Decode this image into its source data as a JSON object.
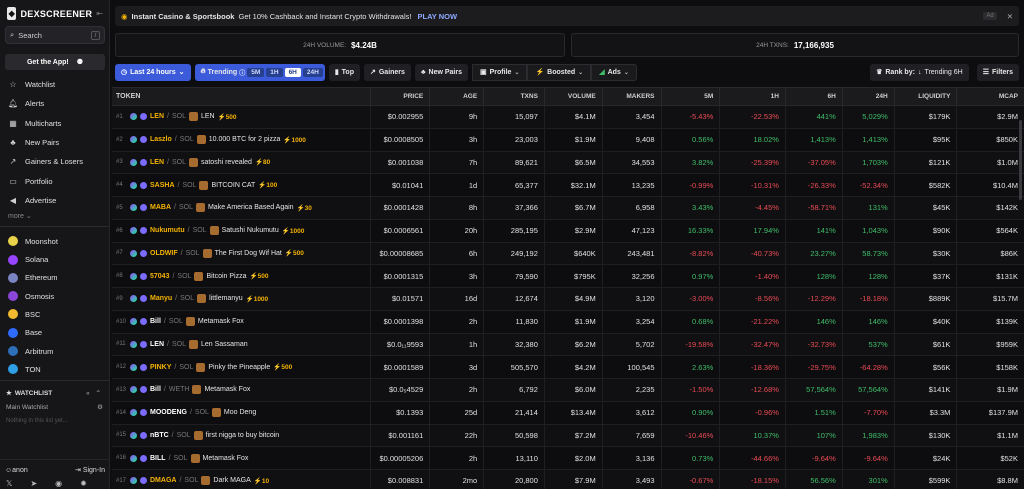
{
  "sidebar": {
    "logo": "DEXSCREENER",
    "search_label": "Search",
    "search_key": "/",
    "get_app": "Get the App!",
    "nav": [
      {
        "label": "Watchlist",
        "icon": "star-icon",
        "glyph": "☆"
      },
      {
        "label": "Alerts",
        "icon": "bell-icon",
        "glyph": "🔔︎"
      },
      {
        "label": "Multicharts",
        "icon": "grid-icon",
        "glyph": "▦"
      },
      {
        "label": "New Pairs",
        "icon": "sprout-icon",
        "glyph": "♣"
      },
      {
        "label": "Gainers & Losers",
        "icon": "trend-icon",
        "glyph": "↗"
      },
      {
        "label": "Portfolio",
        "icon": "folder-icon",
        "glyph": "▭"
      },
      {
        "label": "Advertise",
        "icon": "megaphone-icon",
        "glyph": "◀"
      }
    ],
    "more": "more",
    "chains": [
      {
        "label": "Moonshot",
        "color": "#e8d24a"
      },
      {
        "label": "Solana",
        "color": "#9945ff"
      },
      {
        "label": "Ethereum",
        "color": "#7a84c2"
      },
      {
        "label": "Osmosis",
        "color": "#8b46d9"
      },
      {
        "label": "BSC",
        "color": "#f3ba2f"
      },
      {
        "label": "Base",
        "color": "#2f6bff"
      },
      {
        "label": "Arbitrum",
        "color": "#2d6fb8"
      },
      {
        "label": "TON",
        "color": "#2fa0e6"
      }
    ],
    "watchlist_title": "WATCHLIST",
    "main_watchlist": "Main Watchlist",
    "empty_text": "Nothing in this list yet...",
    "user": "anon",
    "signin": "Sign-In"
  },
  "banner": {
    "brand": "Instant Casino & Sportsbook",
    "text": "Get 10% Cashback and Instant Crypto Withdrawals!",
    "cta": "PLAY NOW",
    "ad": "Ad"
  },
  "stats": {
    "volume_label": "24H VOLUME:",
    "volume_value": "$4.24B",
    "txns_label": "24H TXNS:",
    "txns_value": "17,166,935"
  },
  "toolbar": {
    "timeframe": "Last 24 hours",
    "trending": "Trending",
    "periods": [
      "5M",
      "1H",
      "6H",
      "24H"
    ],
    "selected_period": "6H",
    "top": "Top",
    "gainers": "Gainers",
    "new_pairs": "New Pairs",
    "profile": "Profile",
    "boosted": "Boosted",
    "ads": "Ads",
    "rank_by": "Rank by:",
    "rank_value": "Trending 6H",
    "filters": "Filters"
  },
  "columns": [
    "TOKEN",
    "PRICE",
    "AGE",
    "TXNS",
    "VOLUME",
    "MAKERS",
    "5M",
    "1H",
    "6H",
    "24H",
    "LIQUIDITY",
    "MCAP"
  ],
  "rows": [
    {
      "rank": "#1",
      "sym": "LEN",
      "quote": "SOL",
      "name": "LEN",
      "boost": "500",
      "price": "$0.002955",
      "age": "9h",
      "txns": "15,097",
      "vol": "$4.1M",
      "makers": "3,454",
      "m5": "-5.43%",
      "h1": "-22.53%",
      "h6": "441%",
      "h24": "5,029%",
      "liq": "$179K",
      "mcap": "$2.9M"
    },
    {
      "rank": "#2",
      "sym": "Laszlo",
      "quote": "SOL",
      "name": "10.000 BTC for 2 pizza",
      "boost": "1000",
      "price": "$0.0008505",
      "age": "3h",
      "txns": "23,003",
      "vol": "$1.9M",
      "makers": "9,408",
      "m5": "0.56%",
      "h1": "18.02%",
      "h6": "1,413%",
      "h24": "1,413%",
      "liq": "$95K",
      "mcap": "$850K"
    },
    {
      "rank": "#3",
      "sym": "LEN",
      "quote": "SOL",
      "name": "satoshi revealed",
      "boost": "80",
      "price": "$0.001038",
      "age": "7h",
      "txns": "89,621",
      "vol": "$6.5M",
      "makers": "34,553",
      "m5": "3.82%",
      "h1": "-25.39%",
      "h6": "-37.05%",
      "h24": "1,703%",
      "liq": "$121K",
      "mcap": "$1.0M"
    },
    {
      "rank": "#4",
      "sym": "SASHA",
      "quote": "SOL",
      "name": "BITCOIN CAT",
      "boost": "100",
      "price": "$0.01041",
      "age": "1d",
      "txns": "65,377",
      "vol": "$32.1M",
      "makers": "13,235",
      "m5": "-0.99%",
      "h1": "-10.31%",
      "h6": "-26.33%",
      "h24": "-52.34%",
      "liq": "$582K",
      "mcap": "$10.4M"
    },
    {
      "rank": "#5",
      "sym": "MABA",
      "quote": "SOL",
      "name": "Make America Based Again",
      "boost": "30",
      "price": "$0.0001428",
      "age": "8h",
      "txns": "37,366",
      "vol": "$6.7M",
      "makers": "6,958",
      "m5": "3.43%",
      "h1": "-4.45%",
      "h6": "-58.71%",
      "h24": "131%",
      "liq": "$45K",
      "mcap": "$142K"
    },
    {
      "rank": "#6",
      "sym": "Nukumutu",
      "quote": "SOL",
      "name": "Satushi Nukumutu",
      "boost": "1000",
      "price": "$0.0006561",
      "age": "20h",
      "txns": "285,195",
      "vol": "$2.9M",
      "makers": "47,123",
      "m5": "16.33%",
      "h1": "17.94%",
      "h6": "141%",
      "h24": "1,043%",
      "liq": "$90K",
      "mcap": "$564K"
    },
    {
      "rank": "#7",
      "sym": "OLDWIF",
      "quote": "SOL",
      "name": "The First Dog Wif Hat",
      "boost": "500",
      "price": "$0.00008685",
      "age": "6h",
      "txns": "249,192",
      "vol": "$640K",
      "makers": "243,481",
      "m5": "-8.82%",
      "h1": "-40.73%",
      "h6": "23.27%",
      "h24": "58.73%",
      "liq": "$30K",
      "mcap": "$86K"
    },
    {
      "rank": "#8",
      "sym": "57043",
      "quote": "SOL",
      "name": "Bitcoin Pizza",
      "boost": "500",
      "price": "$0.0001315",
      "age": "3h",
      "txns": "79,590",
      "vol": "$795K",
      "makers": "32,256",
      "m5": "0.97%",
      "h1": "-1.40%",
      "h6": "128%",
      "h24": "128%",
      "liq": "$37K",
      "mcap": "$131K"
    },
    {
      "rank": "#9",
      "sym": "Manyu",
      "quote": "SOL",
      "name": "littlemanyu",
      "boost": "1000",
      "price": "$0.01571",
      "age": "16d",
      "txns": "12,674",
      "vol": "$4.9M",
      "makers": "3,120",
      "m5": "-3.00%",
      "h1": "-8.56%",
      "h6": "-12.29%",
      "h24": "-18.18%",
      "liq": "$889K",
      "mcap": "$15.7M"
    },
    {
      "rank": "#10",
      "sym": "Bill",
      "quote": "SOL",
      "name": "Metamask Fox",
      "boost": "",
      "price": "$0.0001398",
      "age": "2h",
      "txns": "11,830",
      "vol": "$1.9M",
      "makers": "3,254",
      "m5": "0.68%",
      "h1": "-21.22%",
      "h6": "146%",
      "h24": "146%",
      "liq": "$40K",
      "mcap": "$139K"
    },
    {
      "rank": "#11",
      "sym": "LEN",
      "quote": "SOL",
      "name": "Len Sassaman",
      "boost": "",
      "price": "$0.0₁₁9593",
      "age": "1h",
      "txns": "32,380",
      "vol": "$6.2M",
      "makers": "5,702",
      "m5": "-19.58%",
      "h1": "-32.47%",
      "h6": "-32.73%",
      "h24": "537%",
      "liq": "$61K",
      "mcap": "$959K"
    },
    {
      "rank": "#12",
      "sym": "PINKY",
      "quote": "SOL",
      "name": "Pinky the Pineapple",
      "boost": "500",
      "price": "$0.0001589",
      "age": "3d",
      "txns": "505,570",
      "vol": "$4.2M",
      "makers": "100,545",
      "m5": "2.63%",
      "h1": "-18.36%",
      "h6": "-29.75%",
      "h24": "-64.28%",
      "liq": "$56K",
      "mcap": "$158K"
    },
    {
      "rank": "#13",
      "sym": "Bill",
      "quote": "WETH",
      "name": "Metamask Fox",
      "boost": "",
      "price": "$0.0₅4529",
      "age": "2h",
      "txns": "6,792",
      "vol": "$6.0M",
      "makers": "2,235",
      "m5": "-1.50%",
      "h1": "-12.68%",
      "h6": "57,564%",
      "h24": "57,564%",
      "liq": "$141K",
      "mcap": "$1.9M"
    },
    {
      "rank": "#14",
      "sym": "MOODENG",
      "quote": "SOL",
      "name": "Moo Deng",
      "boost": "",
      "price": "$0.1393",
      "age": "25d",
      "txns": "21,414",
      "vol": "$13.4M",
      "makers": "3,612",
      "m5": "0.90%",
      "h1": "-0.96%",
      "h6": "1.51%",
      "h24": "-7.70%",
      "liq": "$3.3M",
      "mcap": "$137.9M"
    },
    {
      "rank": "#15",
      "sym": "nBTC",
      "quote": "SOL",
      "name": "first nigga to buy bitcoin",
      "boost": "",
      "price": "$0.001161",
      "age": "22h",
      "txns": "50,598",
      "vol": "$7.2M",
      "makers": "7,659",
      "m5": "-10.46%",
      "h1": "10.37%",
      "h6": "107%",
      "h24": "1,983%",
      "liq": "$130K",
      "mcap": "$1.1M"
    },
    {
      "rank": "#16",
      "sym": "BILL",
      "quote": "SOL",
      "name": "Metamask Fox",
      "boost": "",
      "price": "$0.00005206",
      "age": "2h",
      "txns": "13,110",
      "vol": "$2.0M",
      "makers": "3,136",
      "m5": "0.73%",
      "h1": "-44.66%",
      "h6": "-9.64%",
      "h24": "-9.64%",
      "liq": "$24K",
      "mcap": "$52K"
    },
    {
      "rank": "#17",
      "sym": "DMAGA",
      "quote": "SOL",
      "name": "Dark MAGA",
      "boost": "10",
      "price": "$0.008831",
      "age": "2mo",
      "txns": "20,800",
      "vol": "$7.9M",
      "makers": "3,493",
      "m5": "-0.67%",
      "h1": "-18.15%",
      "h6": "56.56%",
      "h24": "301%",
      "liq": "$599K",
      "mcap": "$8.8M"
    }
  ]
}
